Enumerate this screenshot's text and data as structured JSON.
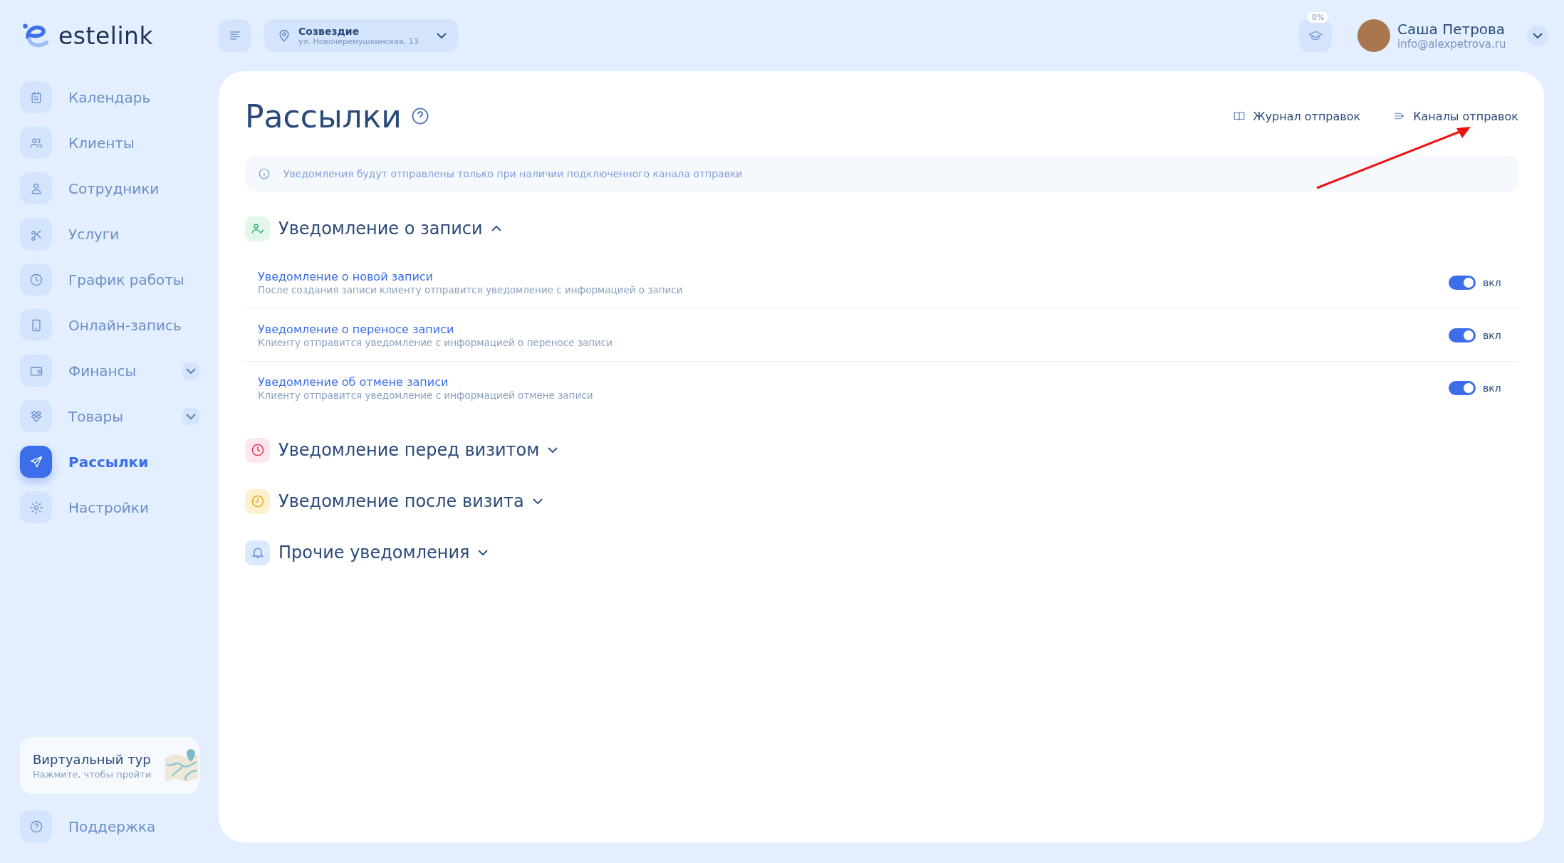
{
  "logo": {
    "text": "estelink"
  },
  "location": {
    "name": "Созвездие",
    "address": "ул. Новочеремушкинская, 13"
  },
  "progress_badge": "0%",
  "user": {
    "name": "Саша Петрова",
    "email": "info@alexpetrova.ru"
  },
  "sidebar": {
    "items": [
      {
        "label": "Календарь",
        "selected": false,
        "expandable": false
      },
      {
        "label": "Клиенты",
        "selected": false,
        "expandable": false
      },
      {
        "label": "Сотрудники",
        "selected": false,
        "expandable": false
      },
      {
        "label": "Услуги",
        "selected": false,
        "expandable": false
      },
      {
        "label": "График работы",
        "selected": false,
        "expandable": false
      },
      {
        "label": "Онлайн-запись",
        "selected": false,
        "expandable": false
      },
      {
        "label": "Финансы",
        "selected": false,
        "expandable": true
      },
      {
        "label": "Товары",
        "selected": false,
        "expandable": true
      },
      {
        "label": "Рассылки",
        "selected": true,
        "expandable": false
      },
      {
        "label": "Настройки",
        "selected": false,
        "expandable": false
      }
    ],
    "tour": {
      "title": "Виртуальный тур",
      "subtitle": "Нажмите, чтобы пройти"
    },
    "support": "Поддержка"
  },
  "page": {
    "title": "Рассылки",
    "links": [
      "Журнал отправок",
      "Каналы отправок"
    ],
    "info": "Уведомления будут отправлены только при наличии подключенного канала отправки",
    "sections": [
      {
        "title": "Уведомление о записи",
        "color": "#e3f7ea",
        "expanded": true,
        "items": [
          {
            "title": "Уведомление о новой записи",
            "description": "После создания записи клиенту отправится уведомление с информацией о записи",
            "on": true,
            "state_label": "вкл"
          },
          {
            "title": "Уведомление о переносе записи",
            "description": "Клиенту отправится уведомление с информацией о переносе записи",
            "on": true,
            "state_label": "вкл"
          },
          {
            "title": "Уведомление об отмене записи",
            "description": "Клиенту отправится уведомление с информацией отмене записи",
            "on": true,
            "state_label": "вкл"
          }
        ]
      },
      {
        "title": "Уведомление перед визитом",
        "color": "#fde7ec",
        "expanded": false
      },
      {
        "title": "Уведомление после визита",
        "color": "#fdf1cf",
        "expanded": false
      },
      {
        "title": "Прочие уведомления",
        "color": "#dbe9fd",
        "expanded": false
      }
    ]
  }
}
